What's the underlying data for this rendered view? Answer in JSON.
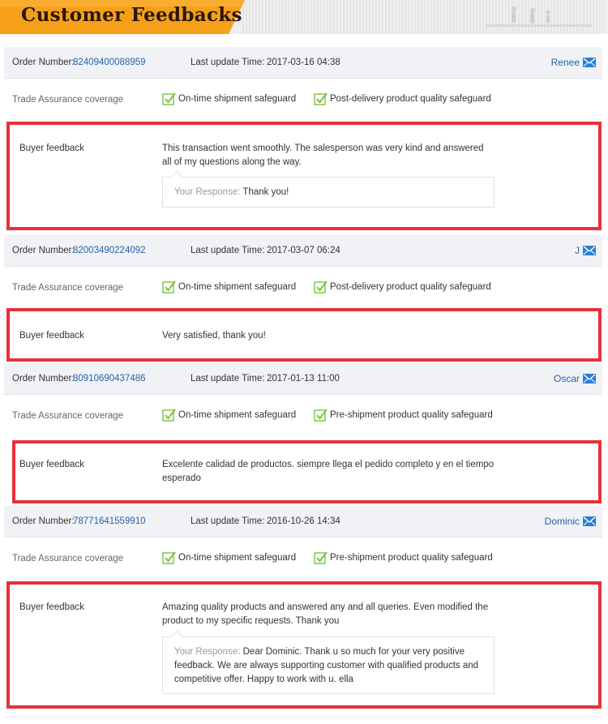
{
  "header": {
    "title": "Customer Feedbacks"
  },
  "labels": {
    "order_number": "Order Number:",
    "last_update": "Last update Time:",
    "coverage": "Trade Assurance coverage",
    "buyer_feedback": "Buyer feedback",
    "your_response": "Your Response:"
  },
  "colors": {
    "link": "#2463a8",
    "highlight": "#e8303a",
    "check": "#7cc243",
    "banner": "#f6a01a"
  },
  "feedbacks": [
    {
      "order_number": "82409400088959",
      "update_time": "2017-03-16 04:38",
      "buyer": "Renee",
      "guard1": "On-time shipment safeguard",
      "guard2": "Post-delivery product quality safeguard",
      "feedback": "This transaction went smoothly. The salesperson was very kind and answered all of my questions along the way.",
      "response": "Thank you!"
    },
    {
      "order_number": "82003490224092",
      "update_time": "2017-03-07 06:24",
      "buyer": "J",
      "guard1": "On-time shipment safeguard",
      "guard2": "Post-delivery product quality safeguard",
      "feedback": "Very satisfied, thank you!"
    },
    {
      "order_number": "80910690437486",
      "update_time": "2017-01-13 11:00",
      "buyer": "Oscar",
      "guard1": "On-time shipment safeguard",
      "guard2": "Pre-shipment product quality safeguard",
      "feedback": "Excelente calidad de productos. siempre llega el pedido completo y en el tiempo esperado"
    },
    {
      "order_number": "78771641559910",
      "update_time": "2016-10-26 14:34",
      "buyer": "Dominic",
      "guard1": "On-time shipment safeguard",
      "guard2": "Pre-shipment product quality safeguard",
      "feedback": "Amazing quality products and answered any and all queries. Even modified the product to my specific requests. Thank you",
      "response": "Dear Dominic. Thank u so much for your very positive feedback. We are always supporting customer with qualified products and competitive offer. Happy to work with u. ella"
    }
  ]
}
